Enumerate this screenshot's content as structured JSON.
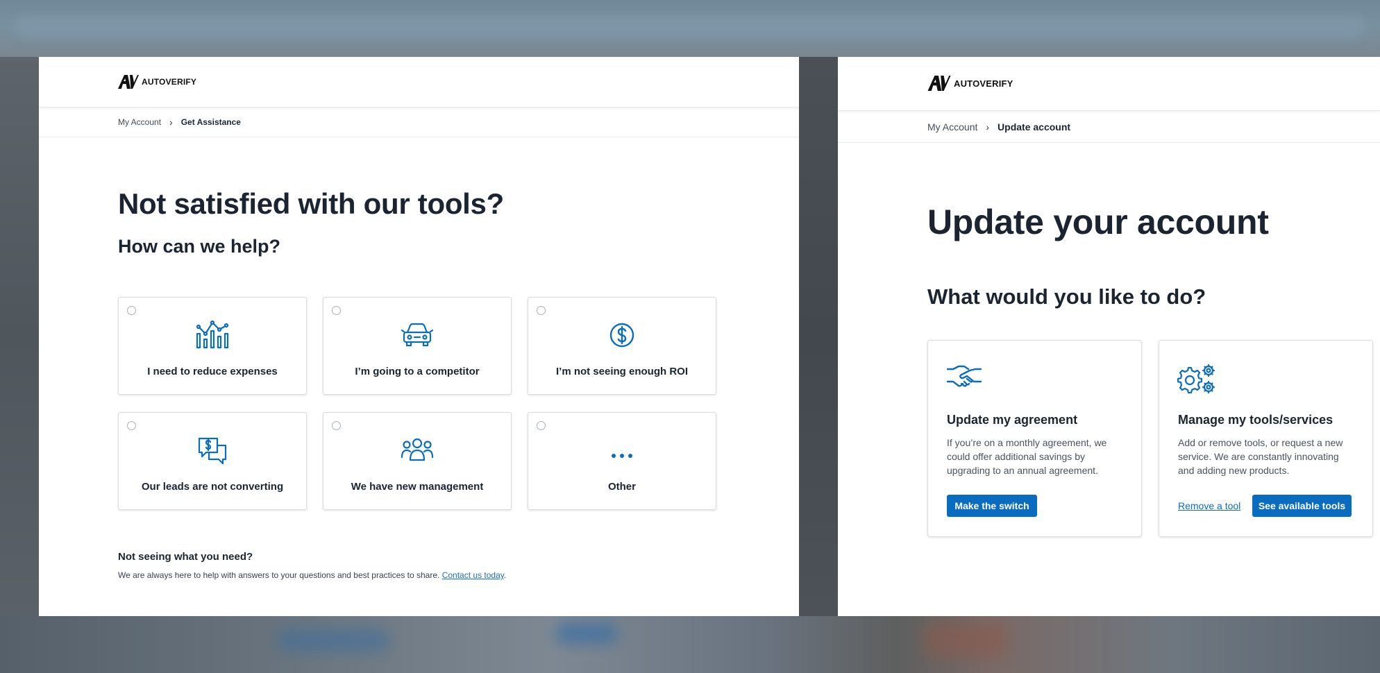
{
  "brand": {
    "name": "AUTOVERIFY",
    "accent": "#0a6cbf"
  },
  "left": {
    "breadcrumb": {
      "parent": "My Account",
      "current": "Get Assistance"
    },
    "title": "Not satisfied with our tools?",
    "subtitle": "How can we help?",
    "options": [
      {
        "label": "I need to reduce expenses",
        "icon": "bar-chart-trend-icon"
      },
      {
        "label": "I’m going to a competitor",
        "icon": "car-icon"
      },
      {
        "label": "I’m not seeing enough ROI",
        "icon": "dollar-circle-icon"
      },
      {
        "label": "Our leads are not converting",
        "icon": "chat-dollar-icon"
      },
      {
        "label": "We have new management",
        "icon": "people-group-icon"
      },
      {
        "label": "Other",
        "icon": "ellipsis-icon"
      }
    ],
    "help": {
      "title": "Not seeing what you need?",
      "text": "We are always here to help with answers to your questions and best practices to share.",
      "link": "Contact us today",
      "suffix": "."
    }
  },
  "right": {
    "breadcrumb": {
      "parent": "My Account",
      "current": "Update account"
    },
    "title": "Update your account",
    "subtitle": "What would you like to do?",
    "cards": [
      {
        "title": "Update my agreement",
        "description": "If you’re on a monthly agreement, we could offer additional savings by upgrading to an annual agreement.",
        "button": "Make the switch",
        "icon": "handshake-icon"
      },
      {
        "title": "Manage my tools/services",
        "description": "Add or remove tools, or request a new service. We are constantly innovating and adding new products.",
        "link": "Remove a tool",
        "button": "See available tools",
        "icon": "gears-icon"
      }
    ]
  }
}
